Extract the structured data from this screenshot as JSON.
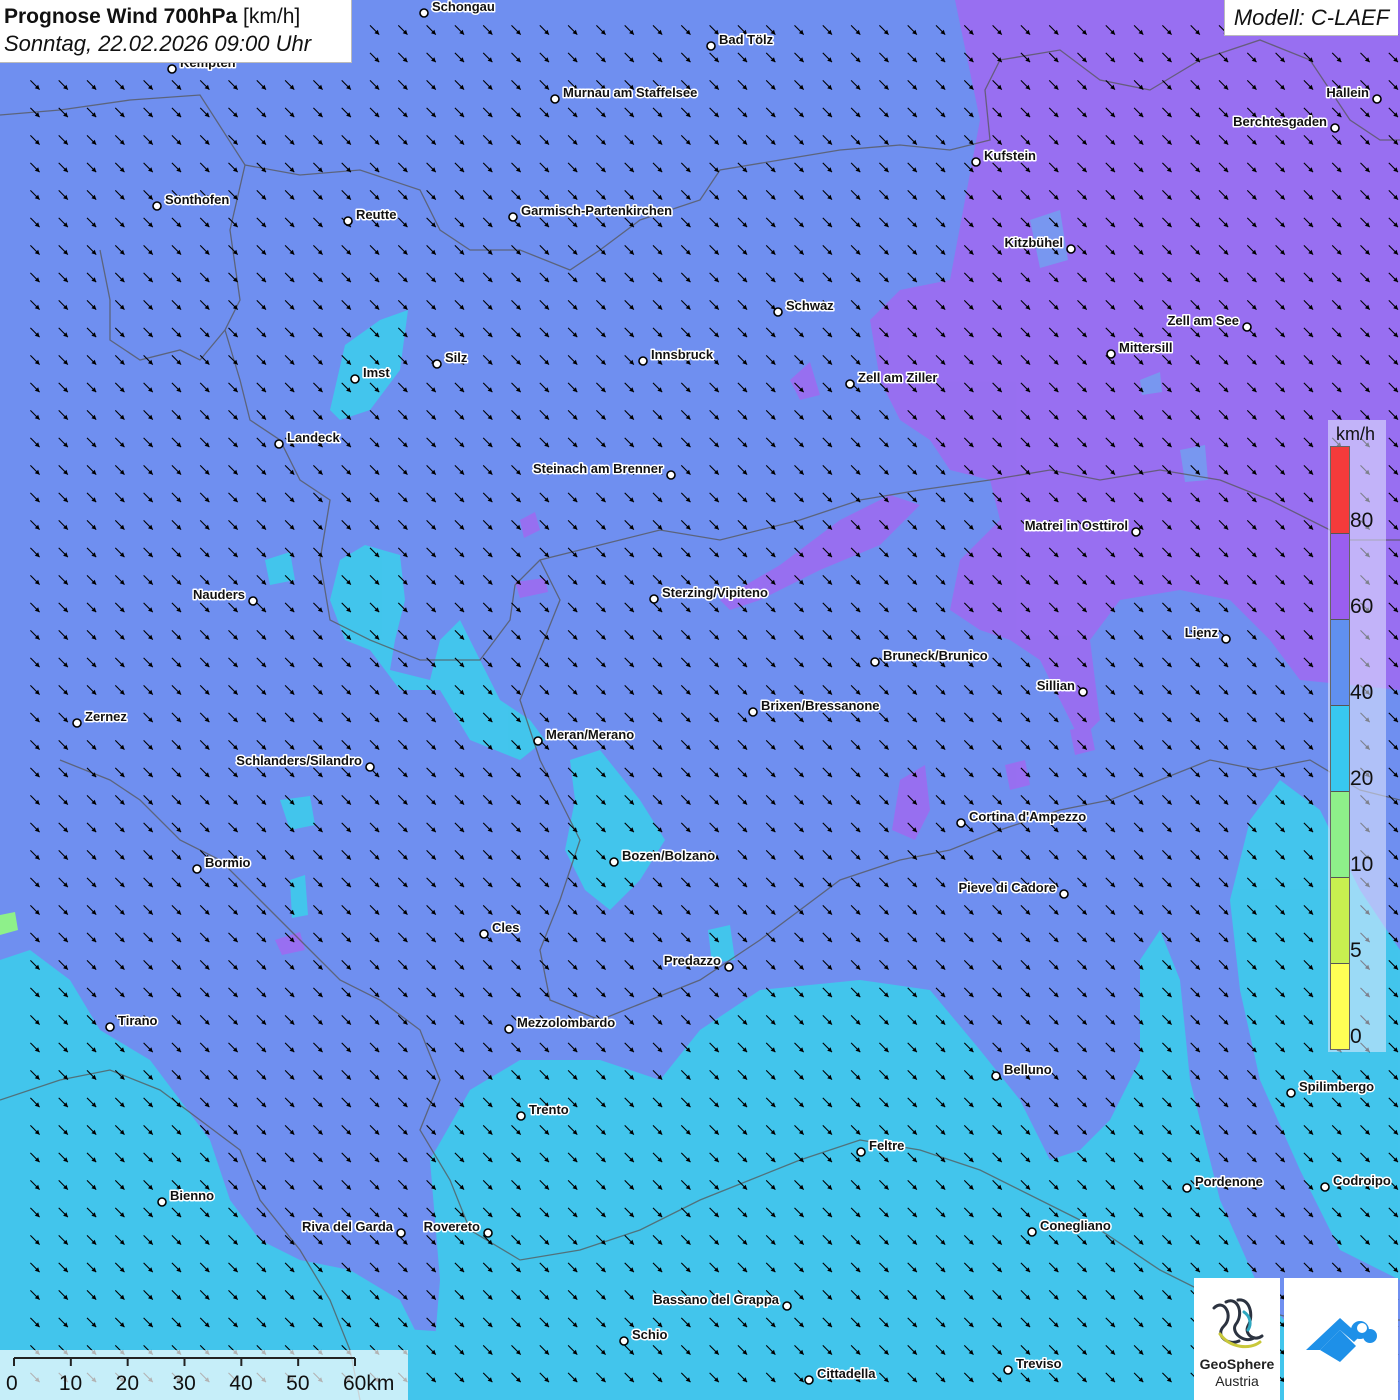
{
  "header": {
    "title_bold": "Prognose Wind 700hPa",
    "title_unit": "[km/h]",
    "subtitle": "Sonntag, 22.02.2026 09:00 Uhr",
    "model": "Modell: C-LAEF"
  },
  "legend": {
    "unit": "km/h",
    "ticks": [
      "0",
      "5",
      "10",
      "20",
      "40",
      "60",
      "80"
    ],
    "colors": [
      "#ffff55",
      "#c8f050",
      "#8ef08a",
      "#38c8f0",
      "#6090f0",
      "#9a5ef0",
      "#f43b3b"
    ]
  },
  "map": {
    "wind_direction_deg_to": 135,
    "dominant_class": "20-40 km/h",
    "region_colors": {
      "base": "#6f8ff0",
      "purple": "#9a6ef0",
      "cyan": "#40c8ec"
    }
  },
  "scale_bar": {
    "labels": [
      "0",
      "10",
      "20",
      "30",
      "40",
      "50",
      "60km"
    ]
  },
  "logos": {
    "geosphere_line1": "GeoSphere",
    "geosphere_line2": "Austria"
  },
  "cities": [
    {
      "name": "Schongau"
    },
    {
      "name": "Bad Tölz"
    },
    {
      "name": "Kempten"
    },
    {
      "name": "Murnau am Staffelsee"
    },
    {
      "name": "Hallein"
    },
    {
      "name": "Berchtesgaden"
    },
    {
      "name": "Kufstein"
    },
    {
      "name": "Sonthofen"
    },
    {
      "name": "Reutte"
    },
    {
      "name": "Garmisch-Partenkirchen"
    },
    {
      "name": "Kitzbühel"
    },
    {
      "name": "Schwaz"
    },
    {
      "name": "Zell am See"
    },
    {
      "name": "Mittersill"
    },
    {
      "name": "Innsbruck"
    },
    {
      "name": "Silz"
    },
    {
      "name": "Imst"
    },
    {
      "name": "Zell am Ziller"
    },
    {
      "name": "Landeck"
    },
    {
      "name": "Steinach am Brenner"
    },
    {
      "name": "Matrei in Osttirol"
    },
    {
      "name": "Nauders"
    },
    {
      "name": "Sterzing/Vipiteno"
    },
    {
      "name": "Lienz"
    },
    {
      "name": "Bruneck/Brunico"
    },
    {
      "name": "Sillian"
    },
    {
      "name": "Zernez"
    },
    {
      "name": "Brixen/Bressanone"
    },
    {
      "name": "Meran/Merano"
    },
    {
      "name": "Schlanders/Silandro"
    },
    {
      "name": "Cortina d'Ampezzo"
    },
    {
      "name": "Bozen/Bolzano"
    },
    {
      "name": "Bormio"
    },
    {
      "name": "Pieve di Cadore"
    },
    {
      "name": "Cles"
    },
    {
      "name": "Predazzo"
    },
    {
      "name": "Tirano"
    },
    {
      "name": "Mezzolombardo"
    },
    {
      "name": "Belluno"
    },
    {
      "name": "Spilimbergo"
    },
    {
      "name": "Trento"
    },
    {
      "name": "Feltre"
    },
    {
      "name": "Pordenone"
    },
    {
      "name": "Codroipo"
    },
    {
      "name": "Bienno"
    },
    {
      "name": "Riva del Garda"
    },
    {
      "name": "Rovereto"
    },
    {
      "name": "Conegliano"
    },
    {
      "name": "Bassano del Grappa"
    },
    {
      "name": "Schio"
    },
    {
      "name": "Treviso"
    },
    {
      "name": "Cittadella"
    }
  ]
}
